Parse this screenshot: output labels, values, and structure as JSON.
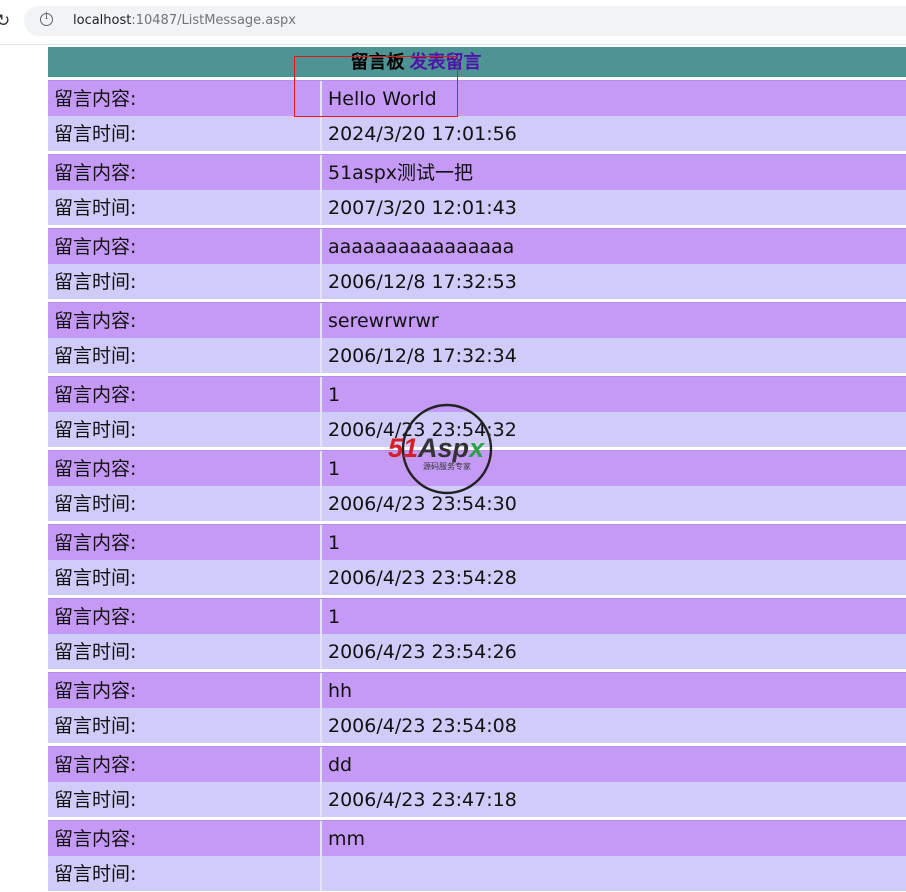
{
  "browser": {
    "url_host": "localhost",
    "url_rest": ":10487/ListMessage.aspx",
    "info_icon": "info-circle-icon",
    "reload_icon": "reload-icon"
  },
  "board": {
    "title": "留言板",
    "post_link": "发表留言"
  },
  "messages": [
    {
      "content_label": "留言内容:",
      "content": "Hello World",
      "time_label": "留言时间:",
      "time": "2024/3/20 17:01:56"
    },
    {
      "content_label": "留言内容:",
      "content": "51aspx测试一把",
      "time_label": "留言时间:",
      "time": "2007/3/20 12:01:43"
    },
    {
      "content_label": "留言内容:",
      "content": "aaaaaaaaaaaaaaaa",
      "time_label": "留言时间:",
      "time": "2006/12/8 17:32:53"
    },
    {
      "content_label": "留言内容:",
      "content": "serewrwrwr",
      "time_label": "留言时间:",
      "time": "2006/12/8 17:32:34"
    },
    {
      "content_label": "留言内容:",
      "content": "1",
      "time_label": "留言时间:",
      "time": "2006/4/23 23:54:32"
    },
    {
      "content_label": "留言内容:",
      "content": "1",
      "time_label": "留言时间:",
      "time": "2006/4/23 23:54:30"
    },
    {
      "content_label": "留言内容:",
      "content": "1",
      "time_label": "留言时间:",
      "time": "2006/4/23 23:54:28"
    },
    {
      "content_label": "留言内容:",
      "content": "1",
      "time_label": "留言时间:",
      "time": "2006/4/23 23:54:26"
    },
    {
      "content_label": "留言内容:",
      "content": "hh",
      "time_label": "留言时间:",
      "time": "2006/4/23 23:54:08"
    },
    {
      "content_label": "留言内容:",
      "content": "dd",
      "time_label": "留言时间:",
      "time": "2006/4/23 23:47:18"
    },
    {
      "content_label": "留言内容:",
      "content": "mm",
      "time_label": "留言时间:",
      "time": ""
    }
  ],
  "watermark": {
    "brand": "51Aspx",
    "tagline": "源码服务专家"
  },
  "colors": {
    "header_bg": "#4f9494",
    "content_row_bg": "#c59af6",
    "time_row_bg": "#cfccfa",
    "link": "#4b16a8",
    "highlight": "#e01818"
  }
}
